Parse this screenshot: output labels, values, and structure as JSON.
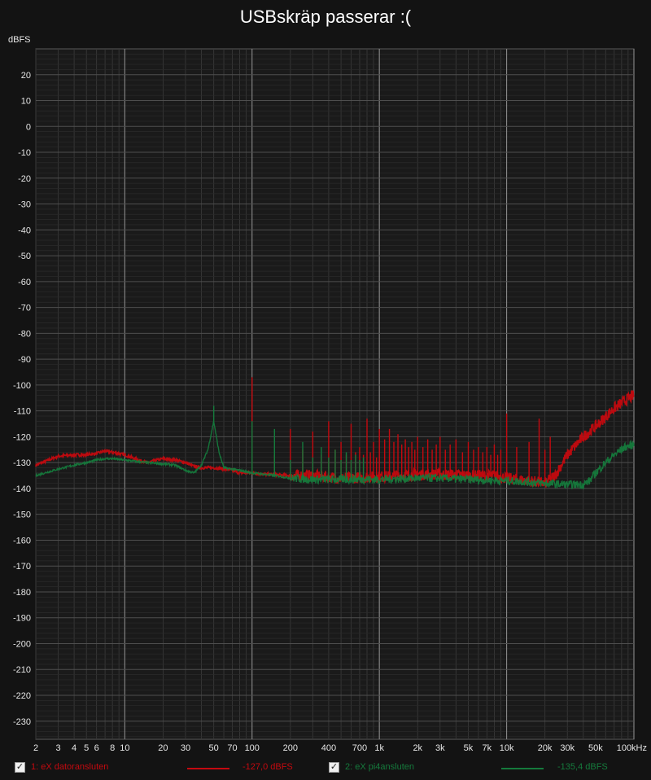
{
  "title": "USBskräp passerar :(",
  "y_unit": "dBFS",
  "colors": {
    "background": "#131313",
    "plot_background": "#1a1a1a",
    "series_1": "#c4090f",
    "series_2": "#157a3c"
  },
  "chart_data": {
    "type": "line",
    "x_scale": "log",
    "xlim": [
      2,
      100000
    ],
    "ylim": [
      -237,
      30
    ],
    "x_ticks": [
      {
        "v": 2,
        "label": "2"
      },
      {
        "v": 3,
        "label": "3"
      },
      {
        "v": 4,
        "label": "4"
      },
      {
        "v": 5,
        "label": "5"
      },
      {
        "v": 6,
        "label": "6"
      },
      {
        "v": 8,
        "label": "8"
      },
      {
        "v": 10,
        "label": "10"
      },
      {
        "v": 20,
        "label": "20"
      },
      {
        "v": 30,
        "label": "30"
      },
      {
        "v": 50,
        "label": "50"
      },
      {
        "v": 70,
        "label": "70"
      },
      {
        "v": 100,
        "label": "100"
      },
      {
        "v": 200,
        "label": "200"
      },
      {
        "v": 400,
        "label": "400"
      },
      {
        "v": 700,
        "label": "700"
      },
      {
        "v": 1000,
        "label": "1k"
      },
      {
        "v": 2000,
        "label": "2k"
      },
      {
        "v": 3000,
        "label": "3k"
      },
      {
        "v": 5000,
        "label": "5k"
      },
      {
        "v": 7000,
        "label": "7k"
      },
      {
        "v": 10000,
        "label": "10k"
      },
      {
        "v": 20000,
        "label": "20k"
      },
      {
        "v": 30000,
        "label": "30k"
      },
      {
        "v": 50000,
        "label": "50k"
      },
      {
        "v": 100000,
        "label": "100kHz"
      }
    ],
    "y_ticks": [
      20,
      10,
      0,
      -10,
      -20,
      -30,
      -40,
      -50,
      -60,
      -70,
      -80,
      -90,
      -100,
      -110,
      -120,
      -130,
      -140,
      -150,
      -160,
      -170,
      -180,
      -190,
      -200,
      -210,
      -220,
      -230
    ],
    "grid": true,
    "legend_position": "bottom",
    "series": [
      {
        "name": "1: eX datoransluten",
        "readout": "-127,0 dBFS",
        "color": "#c4090f",
        "noise": 2.2,
        "points": [
          [
            2,
            -131
          ],
          [
            3,
            -127.5
          ],
          [
            4,
            -127
          ],
          [
            5,
            -127
          ],
          [
            6,
            -126.5
          ],
          [
            7,
            -125.5
          ],
          [
            8,
            -126
          ],
          [
            10,
            -127
          ],
          [
            12,
            -128.5
          ],
          [
            15,
            -130
          ],
          [
            18,
            -129
          ],
          [
            20,
            -128.5
          ],
          [
            25,
            -129
          ],
          [
            30,
            -130
          ],
          [
            35,
            -131.5
          ],
          [
            40,
            -132
          ],
          [
            50,
            -132
          ],
          [
            60,
            -132.5
          ],
          [
            70,
            -133
          ],
          [
            80,
            -134
          ],
          [
            100,
            -134
          ],
          [
            130,
            -134.5
          ],
          [
            200,
            -135
          ],
          [
            300,
            -135
          ],
          [
            500,
            -136
          ],
          [
            1000,
            -135.5
          ],
          [
            2000,
            -134.5
          ],
          [
            3000,
            -134.5
          ],
          [
            5000,
            -135
          ],
          [
            8000,
            -135
          ],
          [
            10000,
            -136
          ],
          [
            15000,
            -137
          ],
          [
            20000,
            -138
          ],
          [
            24000,
            -135
          ],
          [
            30000,
            -127
          ],
          [
            40000,
            -120
          ],
          [
            50000,
            -116
          ],
          [
            70000,
            -109
          ],
          [
            85000,
            -106
          ],
          [
            100000,
            -104
          ]
        ],
        "peaks": [
          [
            100,
            -97
          ],
          [
            150,
            -127
          ],
          [
            200,
            -117
          ],
          [
            250,
            -125
          ],
          [
            300,
            -118
          ],
          [
            350,
            -127
          ],
          [
            400,
            -114
          ],
          [
            450,
            -125
          ],
          [
            500,
            -122
          ],
          [
            550,
            -127
          ],
          [
            600,
            -115
          ],
          [
            650,
            -126
          ],
          [
            700,
            -124
          ],
          [
            750,
            -127
          ],
          [
            800,
            -113
          ],
          [
            850,
            -126
          ],
          [
            900,
            -122
          ],
          [
            950,
            -128
          ],
          [
            1000,
            -117
          ],
          [
            1100,
            -121
          ],
          [
            1200,
            -117
          ],
          [
            1300,
            -122
          ],
          [
            1400,
            -119
          ],
          [
            1500,
            -123
          ],
          [
            1600,
            -121
          ],
          [
            1700,
            -124
          ],
          [
            1800,
            -122
          ],
          [
            1900,
            -125
          ],
          [
            2000,
            -120
          ],
          [
            2200,
            -124
          ],
          [
            2400,
            -121
          ],
          [
            2600,
            -125
          ],
          [
            2800,
            -123
          ],
          [
            3000,
            -120
          ],
          [
            3300,
            -125
          ],
          [
            3600,
            -123
          ],
          [
            4000,
            -121
          ],
          [
            4500,
            -126
          ],
          [
            5000,
            -122
          ],
          [
            5500,
            -125
          ],
          [
            6000,
            -124
          ],
          [
            6500,
            -126
          ],
          [
            7000,
            -124
          ],
          [
            7500,
            -127
          ],
          [
            8000,
            -123
          ],
          [
            8500,
            -127
          ],
          [
            9000,
            -125
          ],
          [
            10000,
            -111
          ],
          [
            12000,
            -124
          ],
          [
            15000,
            -122
          ],
          [
            18000,
            -113
          ],
          [
            20000,
            -125
          ],
          [
            22000,
            -120
          ]
        ]
      },
      {
        "name": "2: eX pi4ansluten",
        "readout": "-135,4 dBFS",
        "color": "#157a3c",
        "noise": 1.6,
        "points": [
          [
            2,
            -135
          ],
          [
            3,
            -132.5
          ],
          [
            4,
            -131
          ],
          [
            5,
            -130
          ],
          [
            6,
            -129
          ],
          [
            7,
            -128.5
          ],
          [
            8,
            -128.5
          ],
          [
            10,
            -129
          ],
          [
            12,
            -129.5
          ],
          [
            15,
            -130
          ],
          [
            20,
            -130.5
          ],
          [
            25,
            -131
          ],
          [
            30,
            -133
          ],
          [
            35,
            -134
          ],
          [
            40,
            -131
          ],
          [
            45,
            -125
          ],
          [
            50,
            -114
          ],
          [
            55,
            -126
          ],
          [
            60,
            -132
          ],
          [
            70,
            -132.5
          ],
          [
            80,
            -133
          ],
          [
            100,
            -134
          ],
          [
            150,
            -135
          ],
          [
            200,
            -136
          ],
          [
            300,
            -136.5
          ],
          [
            500,
            -136.5
          ],
          [
            1000,
            -136.5
          ],
          [
            2000,
            -136
          ],
          [
            3000,
            -136
          ],
          [
            5000,
            -136.5
          ],
          [
            10000,
            -137
          ],
          [
            15000,
            -137.5
          ],
          [
            20000,
            -138
          ],
          [
            30000,
            -138.5
          ],
          [
            40000,
            -138.5
          ],
          [
            45000,
            -137
          ],
          [
            50000,
            -134
          ],
          [
            60000,
            -130
          ],
          [
            70000,
            -127
          ],
          [
            85000,
            -124
          ],
          [
            100000,
            -123
          ]
        ],
        "peaks": [
          [
            50,
            -108
          ],
          [
            100,
            -114
          ],
          [
            150,
            -117
          ],
          [
            200,
            -129
          ],
          [
            250,
            -122
          ],
          [
            300,
            -128
          ],
          [
            350,
            -124
          ],
          [
            400,
            -128
          ],
          [
            450,
            -125
          ],
          [
            500,
            -129
          ],
          [
            550,
            -126
          ],
          [
            600,
            -129
          ],
          [
            650,
            -127
          ],
          [
            700,
            -129
          ],
          [
            750,
            -128
          ]
        ]
      }
    ]
  }
}
